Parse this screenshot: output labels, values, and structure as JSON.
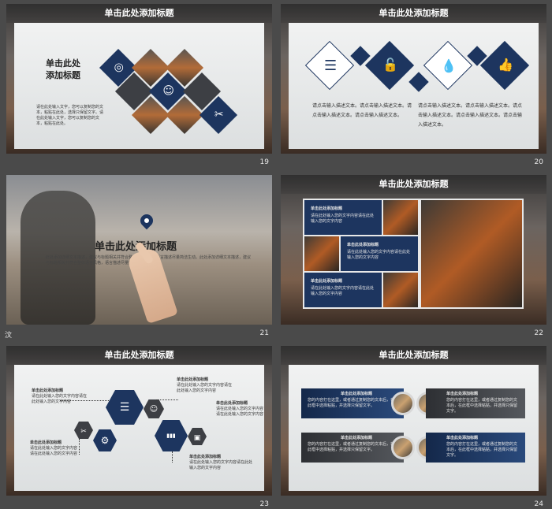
{
  "slides": [
    {
      "number": "19",
      "title": "单击此处添加标题",
      "heading_line1": "单击此处",
      "heading_line2": "添加标题",
      "body": "请在此处输入文字，您可以复制您的文本，粘贴在此处，选择只保留文字。请在此处输入文字，您可以复制您的文本，粘贴在此处。"
    },
    {
      "number": "20",
      "title": "单击此处添加标题",
      "body_col1": "请点击输入描述文本。请点击输入描述文本。请点击输入描述文本。请点击输入描述文本。",
      "body_col2": "请点击输入描述文本。请点击输入描述文本。请点击输入描述文本。请点击输入描述文本。请点击输入描述文本。"
    },
    {
      "number": "21",
      "title": "单击此处添加标题",
      "side_text": "汶",
      "body": "此处添加详细文本描述，建议与标题相关并符合整体语言风格，语言描述尽量简洁生动。此处添加详细文本描述，建议与标题相关并符合整体语言风格，语言描述尽量简洁生动。"
    },
    {
      "number": "22",
      "title": "单击此处添加标题",
      "blocks": [
        {
          "head": "单击此处添加标题",
          "text": "请在此处输入您的文字内容请在此处输入您的文字内容"
        },
        {
          "head": "单击此处添加标题",
          "text": "请在此处输入您的文字内容请在此处输入您的文字内容"
        },
        {
          "head": "单击此处添加标题",
          "text": "请在此处输入您的文字内容请在此处输入您的文字内容"
        }
      ]
    },
    {
      "number": "23",
      "title": "单击此处添加标题",
      "labels": [
        {
          "head": "单击此处添加标题",
          "text": "请在此处输入您的文字内容请在此处输入您的文字内容"
        },
        {
          "head": "单击此处添加标题",
          "text": "请在此处输入您的文字内容请在此处输入您的文字内容"
        },
        {
          "head": "单击此处添加标题",
          "text": "请在此处输入您的文字内容请在此处输入您的文字内容"
        },
        {
          "head": "单击此处添加标题",
          "text": "请在此处输入您的文字内容请在此处输入您的文字内容"
        },
        {
          "head": "单击此处添加标题",
          "text": "请在此处输入您的文字内容请在此处输入您的文字内容"
        }
      ]
    },
    {
      "number": "24",
      "title": "单击此处添加标题",
      "bands": [
        {
          "head": "单击此处添加标题",
          "text": "您的内容打在这里，或者通过复制您的文本后，在此框中选择粘贴，并选择只保留文字。"
        },
        {
          "head": "单击此处添加标题",
          "text": "您的内容打在这里，或者通过复制您的文本后，在此框中选择粘贴，并选择只保留文字。"
        },
        {
          "head": "单击此处添加标题",
          "text": "您的内容打在这里，或者通过复制您的文本后，在此框中选择粘贴，并选择只保留文字。"
        },
        {
          "head": "单击此处添加标题",
          "text": "您的内容打在这里，或者通过复制您的文本后，在此框中选择粘贴，并选择只保留文字。"
        }
      ]
    }
  ],
  "icons": {
    "target": "◎",
    "user": "☺",
    "tools": "✂",
    "list": "☰",
    "lock": "🔓",
    "drop": "💧",
    "thumb": "👍",
    "chat": "☰",
    "gear": "⚙",
    "chart": "▮▮▮",
    "doc": "▣"
  },
  "colors": {
    "navy": "#1d355f",
    "dark_gray": "#3d3f44",
    "background": "#4a4a4a"
  }
}
